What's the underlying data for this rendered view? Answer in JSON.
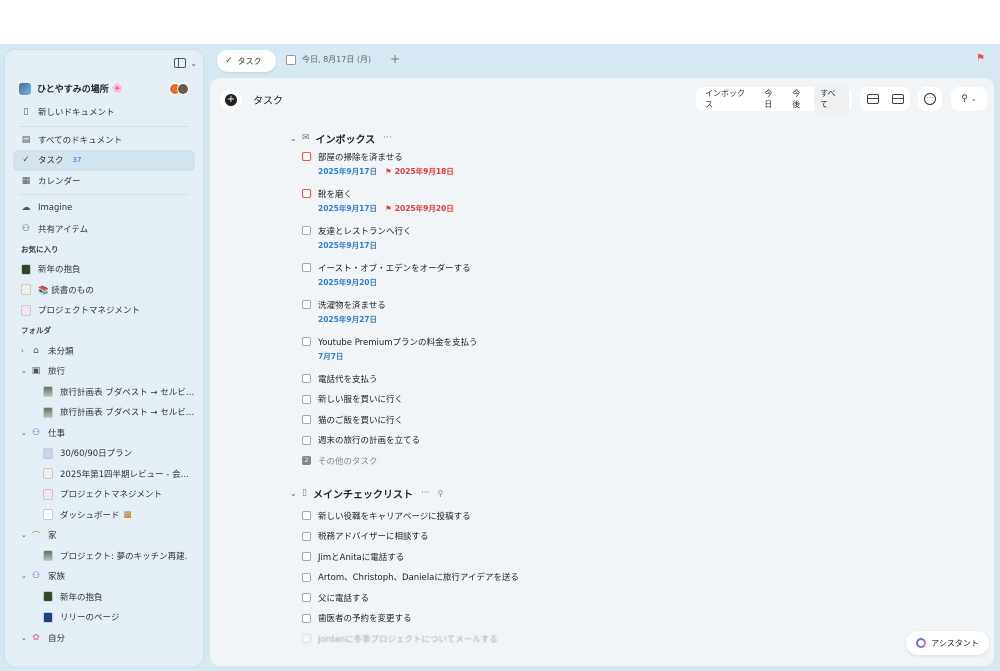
{
  "sidebar": {
    "workspace": {
      "name": "ひとやすみの場所",
      "emoji": "🌸"
    },
    "new_doc": "新しいドキュメント",
    "nav": [
      {
        "label": "すべてのドキュメント",
        "icon": "documents-icon"
      },
      {
        "label": "タスク",
        "icon": "check-circle-icon",
        "badge": "37"
      },
      {
        "label": "カレンダー",
        "icon": "calendar-icon"
      }
    ],
    "nav2": [
      {
        "label": "Imagine",
        "icon": "cloud-icon"
      },
      {
        "label": "共有アイテム",
        "icon": "people-icon"
      }
    ],
    "favorites_title": "お気に入り",
    "favorites": [
      {
        "label": "新年の抱負"
      },
      {
        "label": "📚 読書のもの"
      },
      {
        "label": "プロジェクトマネジメント"
      }
    ],
    "folders_title": "フォルダ",
    "folders": {
      "uncategorized": "未分類",
      "travel": "旅行",
      "travel_items": [
        "旅行計画表 ブダペスト → セルビア...",
        "旅行計画表 ブダペスト → セルビア..."
      ],
      "work": "仕事",
      "work_items": [
        "30/60/90日プラン",
        "2025年第1四半期レビュー - 会議...",
        "プロジェクトマネジメント",
        "ダッシュボード"
      ],
      "home": "家",
      "home_items": [
        "プロジェクト: 夢のキッチン再建."
      ],
      "family": "家族",
      "family_items": [
        "新年の抱負",
        "リリーのページ"
      ],
      "self": "自分"
    }
  },
  "tabs": {
    "active": "タスク",
    "second": "今日, 8月17日 (月)"
  },
  "main": {
    "title": "タスク",
    "filters": [
      "インボックス",
      "今日",
      "今後",
      "すべて"
    ],
    "selected_filter": "すべて",
    "assistant": "アシスタント",
    "inbox": {
      "name": "インボックス",
      "tasks": [
        {
          "title": "部屋の掃除を済ませる",
          "start": "2025年9月17日",
          "due": "2025年9月18日",
          "overdue": true
        },
        {
          "title": "靴を磨く",
          "start": "2025年9月17日",
          "due": "2025年9月20日",
          "overdue": true
        },
        {
          "title": "友達とレストランへ行く",
          "start": "2025年9月17日"
        },
        {
          "title": "イースト・オブ・エデンをオーダーする",
          "start": "2025年9月20日"
        },
        {
          "title": "洗濯物を済ませる",
          "start": "2025年9月27日"
        },
        {
          "title": "Youtube Premiumプランの料金を支払う",
          "start": "7月7日"
        }
      ],
      "plain_tasks": [
        "電話代を支払う",
        "新しい服を買いに行く",
        "猫のご飯を買いに行く",
        "週末の旅行の計画を立てる"
      ],
      "more_count": "2",
      "more_label": "その他のタスク"
    },
    "checklist": {
      "name": "メインチェックリスト",
      "tasks": [
        "新しい役職をキャリアページに投稿する",
        "税務アドバイザーに相談する",
        "JimとAnitaに電話する",
        "Artom、Christoph、Danielaに旅行アイデアを送る",
        "父に電話する",
        "歯医者の予約を変更する",
        "Jordanに冬季プロジェクトについてメールする"
      ]
    }
  }
}
